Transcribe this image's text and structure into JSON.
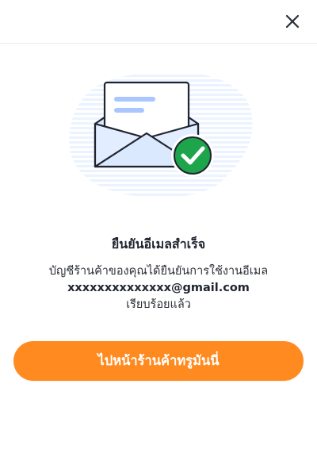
{
  "header": {
    "close_icon": "close-icon"
  },
  "illustration": {
    "icon": "envelope-checkmark-icon",
    "accent_color": "#1ea54c",
    "envelope_fill": "#e2eeff",
    "backdrop_color": "#eaf3ff"
  },
  "content": {
    "title": "ยืนยันอีเมลสำเร็จ",
    "message_line1": "บัญชีร้านค้าของคุณได้ยืนยันการใช้งานอีเมล",
    "email": "xxxxxxxxxxxxxx@gmail.com",
    "message_line3": "เรียบร้อยแล้ว"
  },
  "actions": {
    "primary_label": "ไปหน้าร้านค้าทรูมันนี่",
    "primary_color": "#ff8a1f"
  }
}
